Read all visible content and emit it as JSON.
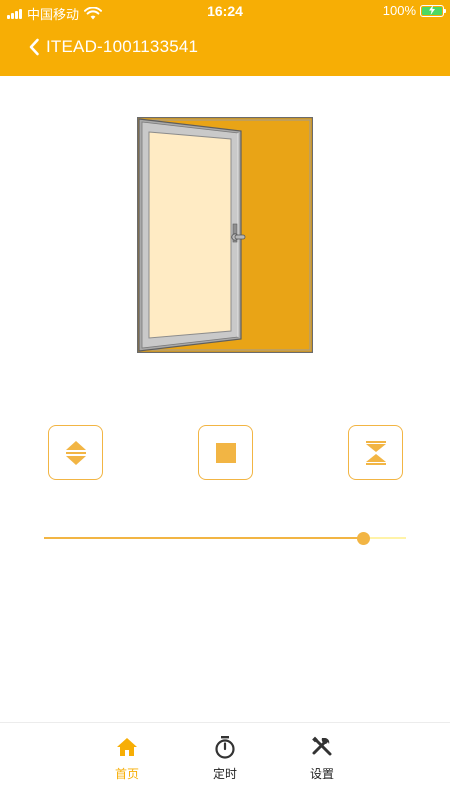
{
  "status_bar": {
    "carrier": "中国移动",
    "time": "16:24",
    "battery": "100%"
  },
  "nav": {
    "title": "ITEAD-1001133541"
  },
  "slider": {
    "value": 0.88
  },
  "tabs": [
    {
      "label": "首页",
      "icon": "home-icon",
      "active": true
    },
    {
      "label": "定时",
      "icon": "timer-icon",
      "active": false
    },
    {
      "label": "设置",
      "icon": "tools-icon",
      "active": false
    }
  ],
  "colors": {
    "brand": "#F7AE05",
    "accent": "#F2B544",
    "slider_track": "#FFF3A8",
    "door_glass": "#FFEBC4",
    "door_back": "#E9A416",
    "battery_fill": "#4CD964"
  }
}
